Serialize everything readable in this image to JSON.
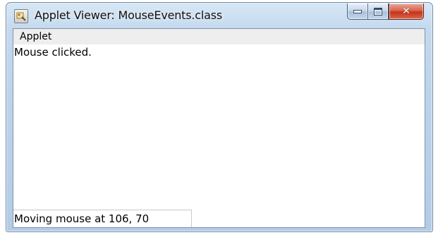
{
  "window": {
    "title": "Applet Viewer: MouseEvents.class",
    "icon": "java-applet-icon",
    "controls": {
      "minimize": "minimize-icon",
      "maximize": "maximize-icon",
      "close": "close-icon",
      "close_glyph": "✕"
    }
  },
  "menubar": {
    "items": [
      {
        "label": "Applet"
      }
    ]
  },
  "applet": {
    "event_message": "Mouse clicked."
  },
  "status": {
    "text": "Moving mouse at 106, 70"
  },
  "colors": {
    "titlebar": "#bcd3ea",
    "close_button": "#c4331a",
    "menubar_bg": "#eeeeee",
    "client_bg": "#ffffff"
  }
}
